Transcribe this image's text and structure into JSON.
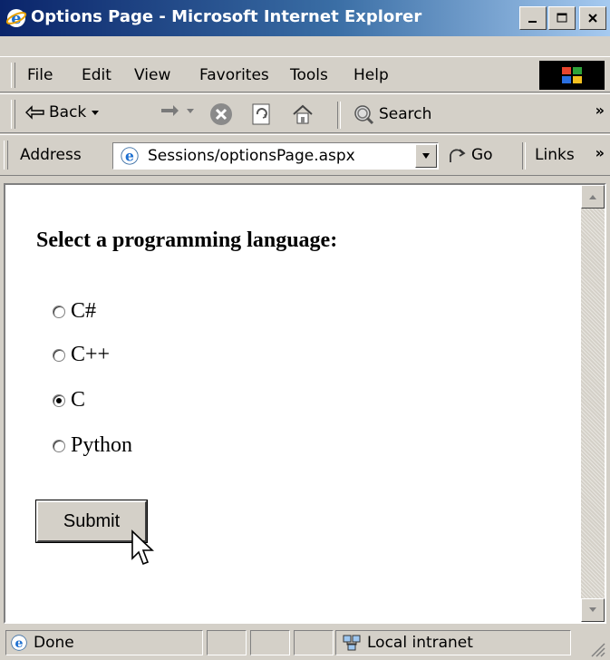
{
  "window": {
    "title": "Options Page - Microsoft Internet Explorer",
    "controls": [
      "minimize",
      "maximize",
      "close"
    ]
  },
  "menubar": {
    "items": [
      "File",
      "Edit",
      "View",
      "Favorites",
      "Tools",
      "Help"
    ]
  },
  "toolbar": {
    "back_label": "Back",
    "search_label": "Search",
    "more": "»"
  },
  "addressbar": {
    "label": "Address",
    "value": "Sessions/optionsPage.aspx",
    "go_label": "Go",
    "links_label": "Links",
    "more": "»"
  },
  "page": {
    "heading": "Select a programming language:",
    "options": [
      {
        "label": "C#",
        "checked": false
      },
      {
        "label": "C++",
        "checked": false
      },
      {
        "label": "C",
        "checked": true
      },
      {
        "label": "Python",
        "checked": false
      }
    ],
    "submit_label": "Submit"
  },
  "statusbar": {
    "status": "Done",
    "zone": "Local intranet"
  },
  "icons": [
    "ie-icon",
    "back-arrow-icon",
    "forward-arrow-icon",
    "stop-icon",
    "refresh-icon",
    "home-icon",
    "search-icon",
    "go-icon",
    "windows-logo-icon",
    "intranet-icon",
    "mouse-cursor-icon"
  ]
}
